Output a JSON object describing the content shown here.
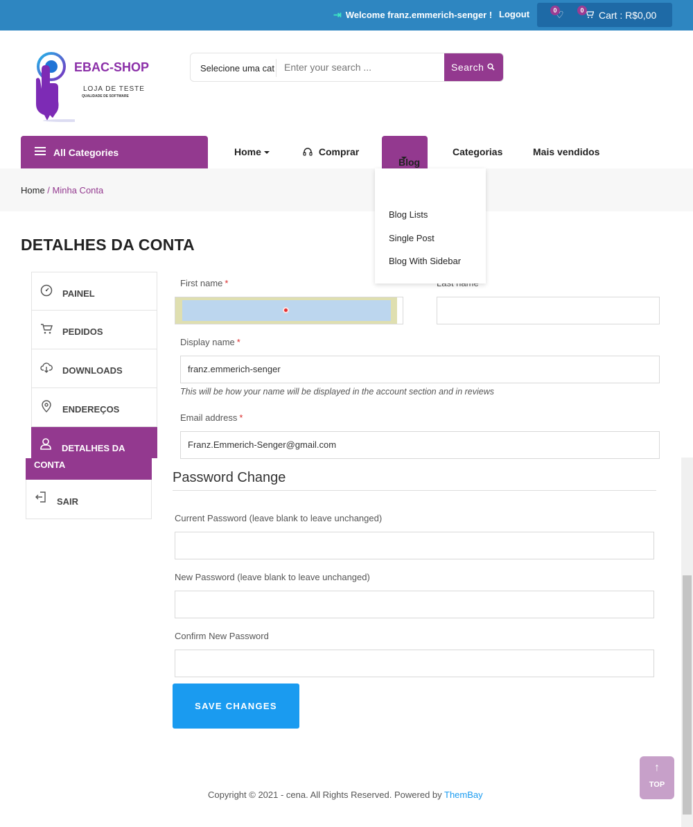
{
  "topbar": {
    "welcome": "Welcome franz.emmerich-senger !",
    "logout": "Logout",
    "wishlist_count": "0",
    "cart_count": "0",
    "cart_label": "Cart : R$0,00"
  },
  "logo": {
    "brand": "EBAC-SHOP",
    "tagline": "LOJA DE TESTE",
    "subtitle": "QUALIDADE DE SOFTWARE"
  },
  "search": {
    "category": "Selecione uma cat",
    "placeholder": "Enter your search ...",
    "button": "Search"
  },
  "nav": {
    "all_categories": "All Categories",
    "items": [
      "Home",
      "Comprar",
      "Blog",
      "Categorias",
      "Mais vendidos"
    ]
  },
  "blog_dropdown": [
    "Blog Lists",
    "Single Post",
    "Blog With Sidebar"
  ],
  "breadcrumb": {
    "home": "Home",
    "separator": " / ",
    "current": "Minha Conta"
  },
  "page_title": "DETALHES DA CONTA",
  "side_menu": {
    "items": [
      "PAINEL",
      "PEDIDOS",
      "DOWNLOADS",
      "ENDEREÇOS"
    ],
    "active_line1": "DETALHES DA",
    "active_line2": "CONTA",
    "logout": "SAIR"
  },
  "form": {
    "first_name_label": "First name",
    "last_name_label": "Last name",
    "display_name_label": "Display name",
    "display_name_value": "franz.emmerich-senger",
    "display_hint": "This will be how your name will be displayed in the account section and in reviews",
    "email_label": "Email address",
    "email_value": "Franz.Emmerich-Senger@gmail.com",
    "required_mark": "*"
  },
  "password": {
    "title": "Password Change",
    "current_label": "Current Password (leave blank to leave unchanged)",
    "new_label": "New Password (leave blank to leave unchanged)",
    "confirm_label": "Confirm New Password"
  },
  "save_button": "SAVE CHANGES",
  "footer": {
    "copyright": "Copyright © 2021 - cena. All Rights Reserved. Powered by ",
    "link": "ThemBay"
  },
  "top_button": "TOP",
  "colors": {
    "topbar": "#2e86c1",
    "brand": "#93398f",
    "primary_button": "#1a9bf0"
  }
}
